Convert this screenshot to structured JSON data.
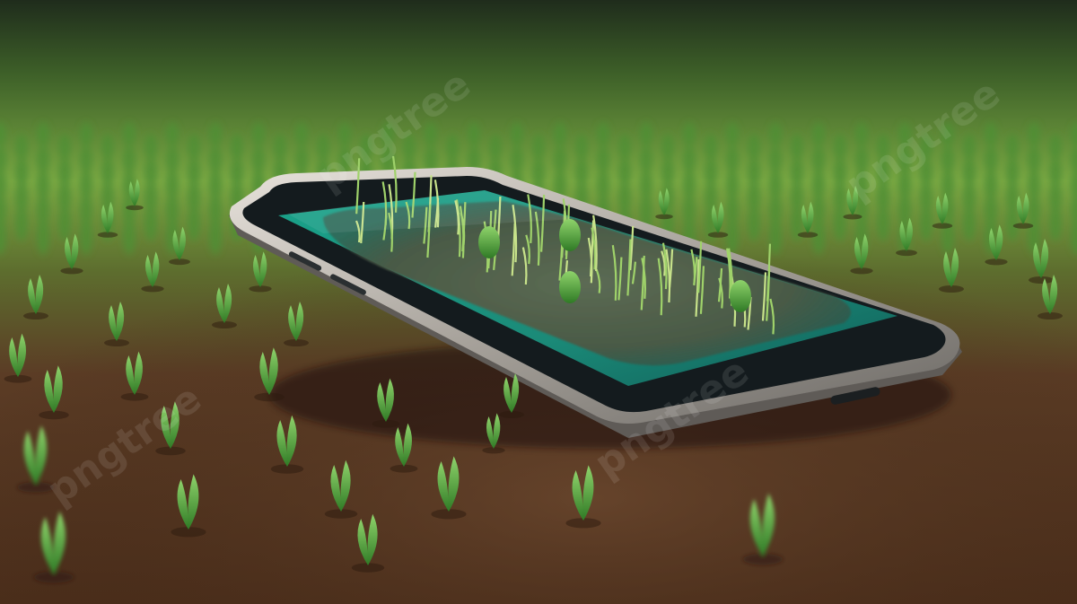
{
  "scene": {
    "subject": "smartphone lying in a field of seedlings",
    "colors": {
      "soil": "#5c3b25",
      "soil_dark": "#3f2615",
      "field_far": "#6f9a3c",
      "seedling": "#4fa83a",
      "phone_frame": "#b9b4ad",
      "phone_bezel": "#151c1f",
      "screen": "#1e8f7c"
    }
  },
  "watermark": {
    "text": "pngtree"
  }
}
